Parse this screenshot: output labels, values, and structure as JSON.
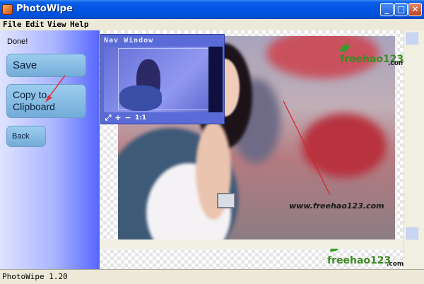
{
  "window": {
    "title": "PhotoWipe",
    "minimize_label": "_",
    "maximize_label": "□",
    "close_label": "✕"
  },
  "menu": [
    "File",
    "Edit",
    "View",
    "Help"
  ],
  "sidebar": {
    "status": "Done!",
    "save_label": "Save",
    "copy_label_line1": "Copy to",
    "copy_label_line2": "Clipboard",
    "back_label": "Back"
  },
  "nav_window": {
    "title": "Nav Window",
    "tools": [
      "⤢",
      "+",
      "−",
      "1:1"
    ]
  },
  "watermarks": {
    "top_brand": "freehao123",
    "top_tld": ".com",
    "mid_url": "www.freehao123.com",
    "bottom_brand": "freehao123",
    "bottom_tld": ".com"
  },
  "statusbar": {
    "version": "PhotoWipe 1.20"
  },
  "colors": {
    "titlebar": "#0054e3",
    "sidebar_gradient_end": "#5566ff",
    "button": "#73acd8",
    "nav_window": "#5a6bd8",
    "arrow": "#e0303a"
  }
}
